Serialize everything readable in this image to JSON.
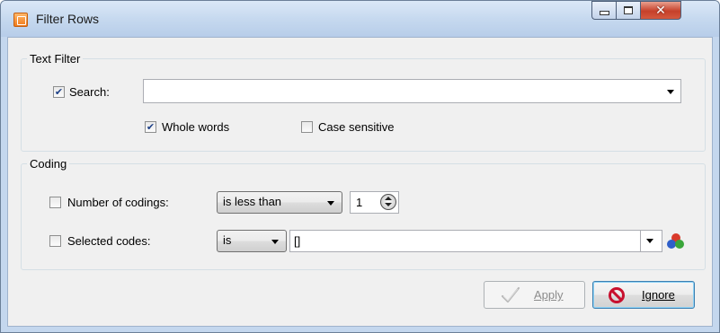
{
  "window": {
    "title": "Filter Rows"
  },
  "text_filter": {
    "group_label": "Text Filter",
    "search": {
      "label": "Search:",
      "checked": true,
      "value": ""
    },
    "whole_words": {
      "label": "Whole words",
      "checked": true
    },
    "case_sensitive": {
      "label": "Case sensitive",
      "checked": false
    }
  },
  "coding": {
    "group_label": "Coding",
    "number_of_codings": {
      "label": "Number of codings:",
      "checked": false,
      "operator": "is less than",
      "value": "1"
    },
    "selected_codes": {
      "label": "Selected codes:",
      "checked": false,
      "operator": "is",
      "value": "[]"
    }
  },
  "buttons": {
    "apply": {
      "label": "Apply",
      "mnemonic": "A",
      "enabled": false
    },
    "ignore": {
      "label": "Ignore",
      "mnemonic": "I",
      "enabled": true
    }
  },
  "icons": {
    "app": "filter-rows-app-icon",
    "minimize": "minimize-icon",
    "maximize": "maximize-icon",
    "close": "close-icon",
    "apply": "checkmark-icon",
    "ignore": "prohibited-icon",
    "codes": "colored-circles-codes-icon"
  },
  "colors": {
    "titlebar": "#c6d9ef",
    "close_button": "#c6402a",
    "ignore_icon": "#c8102e",
    "codes_red": "#d93a2b",
    "codes_green": "#3aa63a",
    "codes_blue": "#2f5fc9"
  }
}
